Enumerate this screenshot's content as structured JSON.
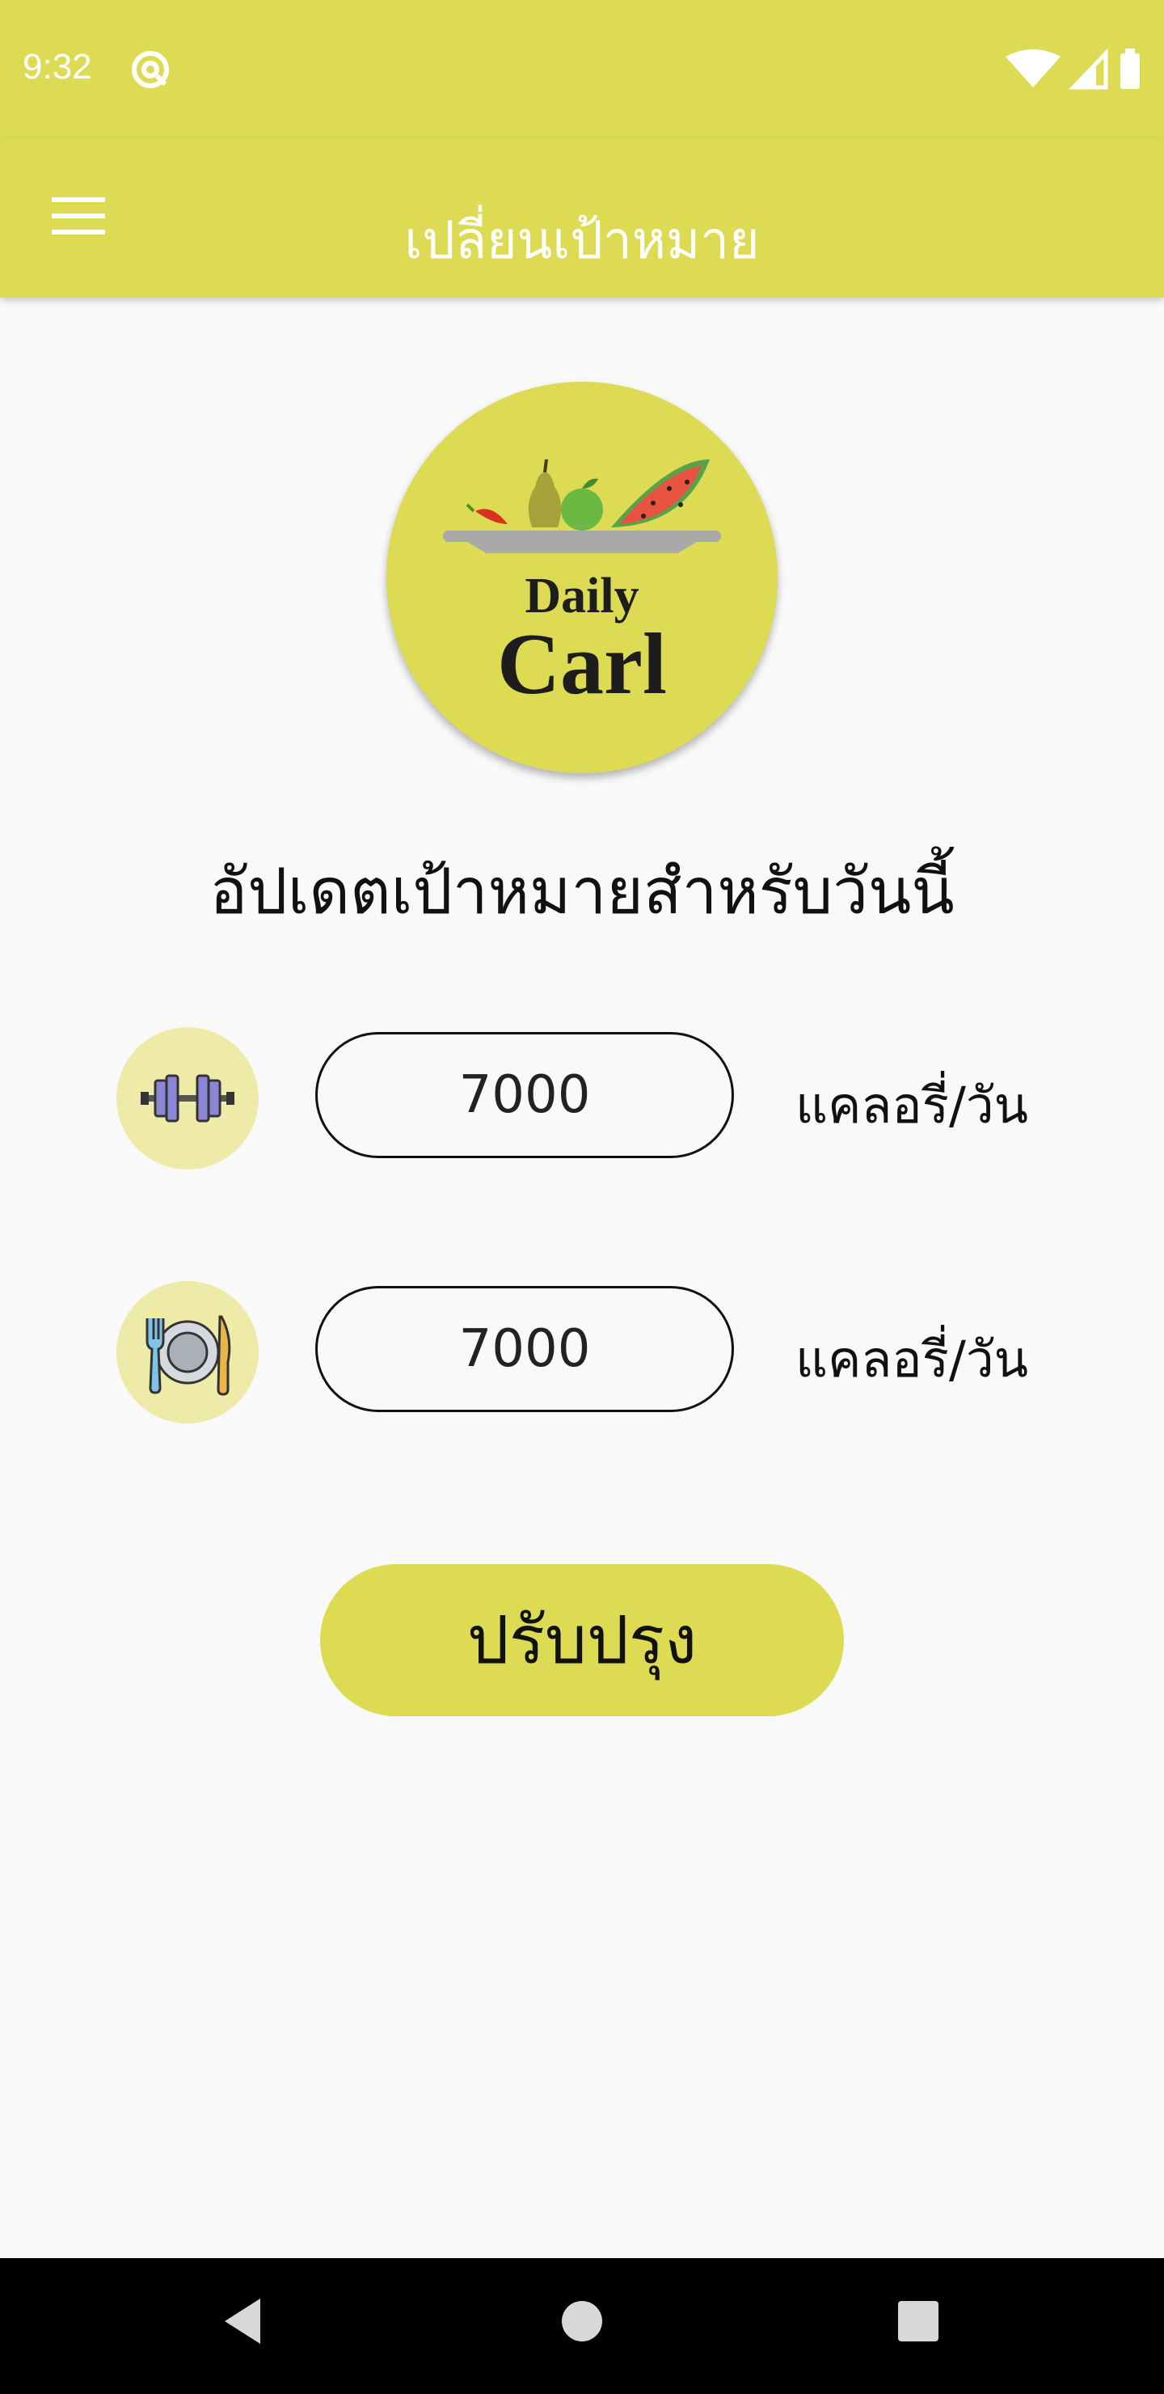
{
  "status_bar": {
    "time": "9:32",
    "icons": [
      "at-sign-icon",
      "wifi-icon",
      "signal-icon",
      "battery-icon"
    ]
  },
  "app_bar": {
    "title": "เปลี่ยนเป้าหมาย",
    "menu_icon": "hamburger-menu-icon"
  },
  "logo": {
    "line1": "Daily",
    "line2": "Carl"
  },
  "heading": "อัปเดตเป้าหมายสำหรับวันนี้",
  "goals": [
    {
      "icon": "dumbbell-icon",
      "value": "7000",
      "unit": "แคลอรี่/วัน"
    },
    {
      "icon": "plate-fork-knife-icon",
      "value": "7000",
      "unit": "แคลอรี่/วัน"
    }
  ],
  "submit_label": "ปรับปรุง",
  "nav_bar": {
    "icons": [
      "back-icon",
      "home-icon",
      "recents-icon"
    ]
  },
  "colors": {
    "accent": "#dcdb53",
    "icon_bg": "#eeeba8",
    "background": "#f9f9f9"
  }
}
